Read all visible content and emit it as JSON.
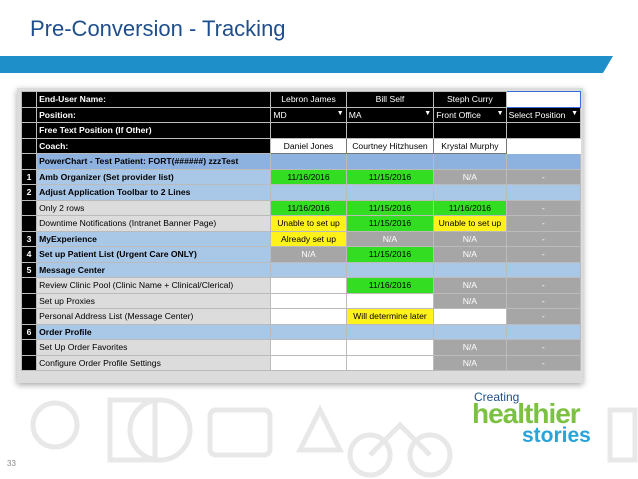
{
  "slide": {
    "title": "Pre-Conversion - Tracking",
    "page_number": "33",
    "accent_color": "#1f8fc9",
    "title_color": "#1f4e8c"
  },
  "logo": {
    "line1": "Creating",
    "line2": "healthier",
    "line3": "stories",
    "colors": {
      "line1": "#1f4e8c",
      "line2": "#7cc142",
      "line3": "#29a3d8"
    }
  },
  "sheet": {
    "header": {
      "end_user_label": "End-User Name:",
      "position_label": "Position:",
      "free_text_label": "Free Text Position (If Other)",
      "coach_label": "Coach:",
      "users": [
        "Lebron James",
        "Bill Self",
        "Steph Curry",
        ""
      ],
      "positions": [
        "MD",
        "MA",
        "Front Office",
        "Select Position"
      ],
      "coaches": [
        "Daniel Jones",
        "Courtney Hitzhusen",
        "Krystal Murphy",
        ""
      ]
    },
    "powerchart_label": "PowerChart - Test Patient: FORT(######) zzzTest",
    "rows": [
      {
        "num": "1",
        "label": "Amb Organizer (Set provider list)",
        "kind": "sec",
        "cells": [
          {
            "t": "11/16/2016",
            "s": "green"
          },
          {
            "t": "11/15/2016",
            "s": "green"
          },
          {
            "t": "N/A",
            "s": "gray"
          },
          {
            "t": "-",
            "s": "gray"
          }
        ]
      },
      {
        "num": "2",
        "label": "Adjust Application Toolbar to 2 Lines",
        "kind": "sec",
        "cells": []
      },
      {
        "num": "",
        "label": "Only 2 rows",
        "kind": "item",
        "cells": [
          {
            "t": "11/16/2016",
            "s": "green"
          },
          {
            "t": "11/15/2016",
            "s": "green"
          },
          {
            "t": "11/16/2016",
            "s": "green"
          },
          {
            "t": "-",
            "s": "gray"
          }
        ]
      },
      {
        "num": "",
        "label": "Downtime Notifications (Intranet Banner Page)",
        "kind": "item",
        "cells": [
          {
            "t": "Unable to set up",
            "s": "yellow"
          },
          {
            "t": "11/15/2016",
            "s": "green"
          },
          {
            "t": "Unable to set up",
            "s": "yellow"
          },
          {
            "t": "-",
            "s": "gray"
          }
        ]
      },
      {
        "num": "3",
        "label": "MyExperience",
        "kind": "sec",
        "cells": [
          {
            "t": "Already set up",
            "s": "yellow"
          },
          {
            "t": "N/A",
            "s": "gray"
          },
          {
            "t": "N/A",
            "s": "gray"
          },
          {
            "t": "-",
            "s": "gray"
          }
        ]
      },
      {
        "num": "4",
        "label": "Set up Patient List (Urgent Care ONLY)",
        "kind": "sec",
        "cells": [
          {
            "t": "N/A",
            "s": "gray"
          },
          {
            "t": "11/15/2016",
            "s": "green"
          },
          {
            "t": "N/A",
            "s": "gray"
          },
          {
            "t": "-",
            "s": "gray"
          }
        ]
      },
      {
        "num": "5",
        "label": "Message Center",
        "kind": "sec",
        "cells": []
      },
      {
        "num": "",
        "label": "Review Clinic Pool (Clinic Name + Clinical/Clerical)",
        "kind": "item",
        "cells": [
          {
            "t": "",
            "s": "white"
          },
          {
            "t": "11/16/2016",
            "s": "green"
          },
          {
            "t": "N/A",
            "s": "gray"
          },
          {
            "t": "-",
            "s": "gray"
          }
        ]
      },
      {
        "num": "",
        "label": "Set up Proxies",
        "kind": "item",
        "cells": [
          {
            "t": "",
            "s": "white"
          },
          {
            "t": "",
            "s": "white"
          },
          {
            "t": "N/A",
            "s": "gray"
          },
          {
            "t": "-",
            "s": "gray"
          }
        ]
      },
      {
        "num": "",
        "label": "Personal Address List (Message Center)",
        "kind": "item",
        "cells": [
          {
            "t": "",
            "s": "white"
          },
          {
            "t": "Will determine later",
            "s": "yellow"
          },
          {
            "t": "",
            "s": "white"
          },
          {
            "t": "-",
            "s": "gray"
          }
        ]
      },
      {
        "num": "6",
        "label": "Order Profile",
        "kind": "sec",
        "cells": []
      },
      {
        "num": "",
        "label": "Set Up Order Favorites",
        "kind": "item",
        "cells": [
          {
            "t": "",
            "s": "white"
          },
          {
            "t": "",
            "s": "white"
          },
          {
            "t": "N/A",
            "s": "gray"
          },
          {
            "t": "-",
            "s": "gray"
          }
        ]
      },
      {
        "num": "",
        "label": "Configure Order Profile Settings",
        "kind": "item",
        "cells": [
          {
            "t": "",
            "s": "white"
          },
          {
            "t": "",
            "s": "white"
          },
          {
            "t": "N/A",
            "s": "gray"
          },
          {
            "t": "-",
            "s": "gray"
          }
        ]
      }
    ]
  }
}
